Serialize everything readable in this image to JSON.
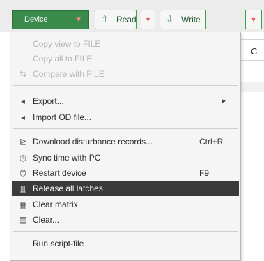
{
  "toolbar": {
    "device_label": "Device",
    "read_label": "Read",
    "write_label": "Write"
  },
  "background": {
    "fragment": "C"
  },
  "menu": {
    "copy_view": "Copy view to FILE",
    "copy_all": "Copy all to FILE",
    "compare": "Compare with FILE",
    "export": "Export...",
    "import_od": "Import OD file...",
    "download": "Download disturbance records...",
    "download_shortcut": "Ctrl+R",
    "sync_time": "Sync time with PC",
    "restart": "Restart device",
    "restart_shortcut": "F9",
    "release_latches": "Release all latches",
    "clear_matrix": "Clear matrix",
    "clear": "Clear...",
    "run_script": "Run script-file"
  },
  "colors": {
    "accent_green": "#3aa347",
    "menu_highlight": "#3a3a3a"
  }
}
